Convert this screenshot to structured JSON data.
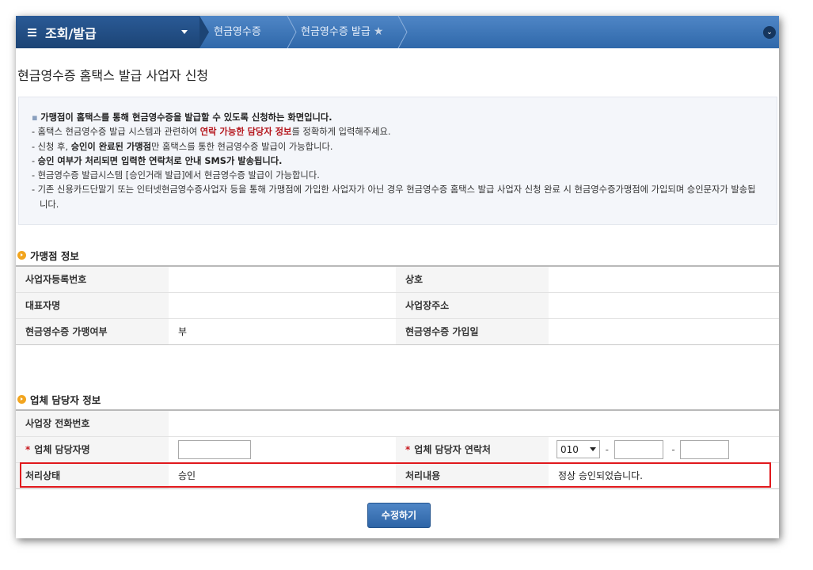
{
  "topbar": {
    "menu_title": "조회/발급",
    "breadcrumbs": [
      "현금영수증",
      "현금영수증 발급"
    ]
  },
  "page_title": "현금영수증 홈택스 발급 사업자 신청",
  "notice": {
    "line1": "가맹점이 홈택스를 통해 현금영수증을 발급할 수 있도록 신청하는 화면입니다.",
    "line2_a": "- 홈택스 현금영수증 발급 시스템과 관련하여 ",
    "line2_b": "연락 가능한 담당자 정보",
    "line2_c": "를 정확하게 입력해주세요.",
    "line3_a": "- 신청 후, ",
    "line3_b": "승인이 완료된 가맹점",
    "line3_c": "만 홈택스를 통한 현금영수증 발급이 가능합니다.",
    "line4_a": "- ",
    "line4_b": "승인 여부가 처리되면 입력한 연락처로 안내 SMS가 발송됩니다.",
    "line5": "- 현금영수증 발급시스템 [승인거래 발급]에서 현금영수증 발급이 가능합니다.",
    "line6": "- 기존 신용카드단말기 또는 인터넷현금영수증사업자 등을 통해 가맹점에 가입한 사업자가 아닌 경우 현금영수증 홈택스 발급 사업자 신청 완료 시 현금영수증가맹점에 가입되며 승인문자가 발송됩니다."
  },
  "merchant": {
    "section_title": "가맹점 정보",
    "biz_no_label": "사업자등록번호",
    "biz_no_value": "",
    "company_label": "상호",
    "company_value": "",
    "ceo_label": "대표자명",
    "ceo_value": "",
    "address_label": "사업장주소",
    "address_value": "",
    "joined_label": "현금영수증 가맹여부",
    "joined_value": "부",
    "join_date_label": "현금영수증 가입일",
    "join_date_value": ""
  },
  "contact": {
    "section_title": "업체 담당자 정보",
    "phone_label": "사업장 전화번호",
    "phone_value": "",
    "manager_label": "업체 담당자명",
    "manager_value": "",
    "manager_phone_label": "업체 담당자 연락처",
    "phone_prefix": "010",
    "phone_mid": "",
    "phone_last": "",
    "dash": "-",
    "required_mark": "*",
    "status_label": "처리상태",
    "status_value": "승인",
    "result_label": "처리내용",
    "result_value": "정상 승인되었습니다."
  },
  "buttons": {
    "modify": "수정하기"
  },
  "colors": {
    "topbar": "#3a74b8",
    "menu_block": "#214b80",
    "highlight_border": "#e0181c",
    "emphasis_red": "#b5171e"
  }
}
